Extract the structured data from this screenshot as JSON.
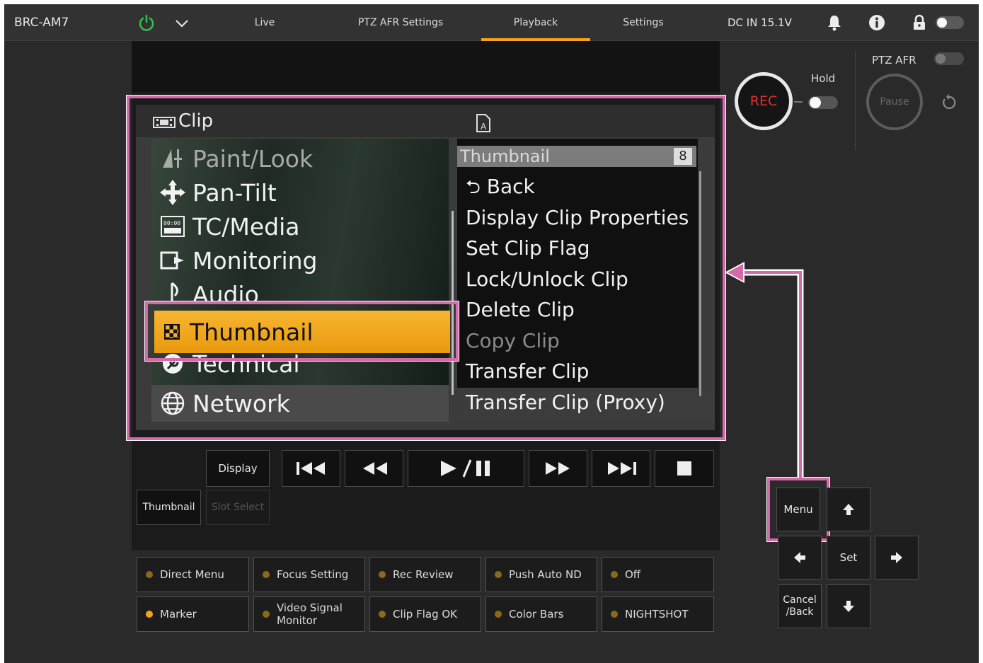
{
  "topbar": {
    "device_name": "BRC-AM7",
    "tabs": [
      {
        "label": "Live",
        "active": false
      },
      {
        "label": "PTZ AFR Settings",
        "active": false
      },
      {
        "label": "Playback",
        "active": true
      },
      {
        "label": "Settings",
        "active": false
      }
    ],
    "power_status": "DC IN 15.1V",
    "icons": [
      "power-icon",
      "chevron-down-icon",
      "bell-icon",
      "info-icon",
      "lock-icon"
    ]
  },
  "menu": {
    "title": "Clip",
    "left_items": [
      {
        "label": "Paint/Look",
        "icon": "paint-look-icon",
        "dim": true
      },
      {
        "label": "Pan-Tilt",
        "icon": "pan-tilt-icon",
        "dim": false
      },
      {
        "label": "TC/Media",
        "icon": "tc-media-icon",
        "dim": false
      },
      {
        "label": "Monitoring",
        "icon": "monitoring-icon",
        "dim": false
      },
      {
        "label": "Audio",
        "icon": "audio-icon",
        "dim": false
      },
      {
        "label": "Thumbnail",
        "icon": "thumbnail-icon",
        "dim": false,
        "selected": true
      },
      {
        "label": "Technical",
        "icon": "technical-icon",
        "dim": false
      },
      {
        "label": "Network",
        "icon": "network-icon",
        "dim": false
      }
    ],
    "right_header": "Thumbnail",
    "right_badge": "8",
    "right_items": [
      {
        "label": "Back",
        "dim": false
      },
      {
        "label": "Display Clip Properties",
        "dim": false
      },
      {
        "label": "Set Clip Flag",
        "dim": false
      },
      {
        "label": "Lock/Unlock Clip",
        "dim": false
      },
      {
        "label": "Delete Clip",
        "dim": false
      },
      {
        "label": "Copy Clip",
        "dim": true
      },
      {
        "label": "Transfer Clip",
        "dim": false
      },
      {
        "label": "Transfer Clip (Proxy)",
        "dim": false
      }
    ]
  },
  "transport": {
    "display_label": "Display",
    "thumbnail_label": "Thumbnail",
    "slot_select_label": "Slot Select"
  },
  "function_buttons": [
    {
      "label": "Direct Menu",
      "on": false
    },
    {
      "label": "Focus Setting",
      "on": false
    },
    {
      "label": "Rec Review",
      "on": false
    },
    {
      "label": "Push Auto ND",
      "on": false
    },
    {
      "label": "Off",
      "on": false
    },
    {
      "label": "Marker",
      "on": true
    },
    {
      "label": "Video Signal Monitor",
      "on": false
    },
    {
      "label": "Clip Flag OK",
      "on": false
    },
    {
      "label": "Color Bars",
      "on": false
    },
    {
      "label": "NIGHTSHOT",
      "on": false
    }
  ],
  "right_panel": {
    "rec_label": "REC",
    "hold_label": "Hold",
    "ptz_label": "PTZ AFR",
    "pause_label": "Pause",
    "menu_label": "Menu",
    "set_label": "Set",
    "cancel_label": "Cancel\n/Back"
  },
  "colors": {
    "accent": "#f4a21a",
    "highlight": "#d46aa9",
    "rec": "#e23030"
  }
}
